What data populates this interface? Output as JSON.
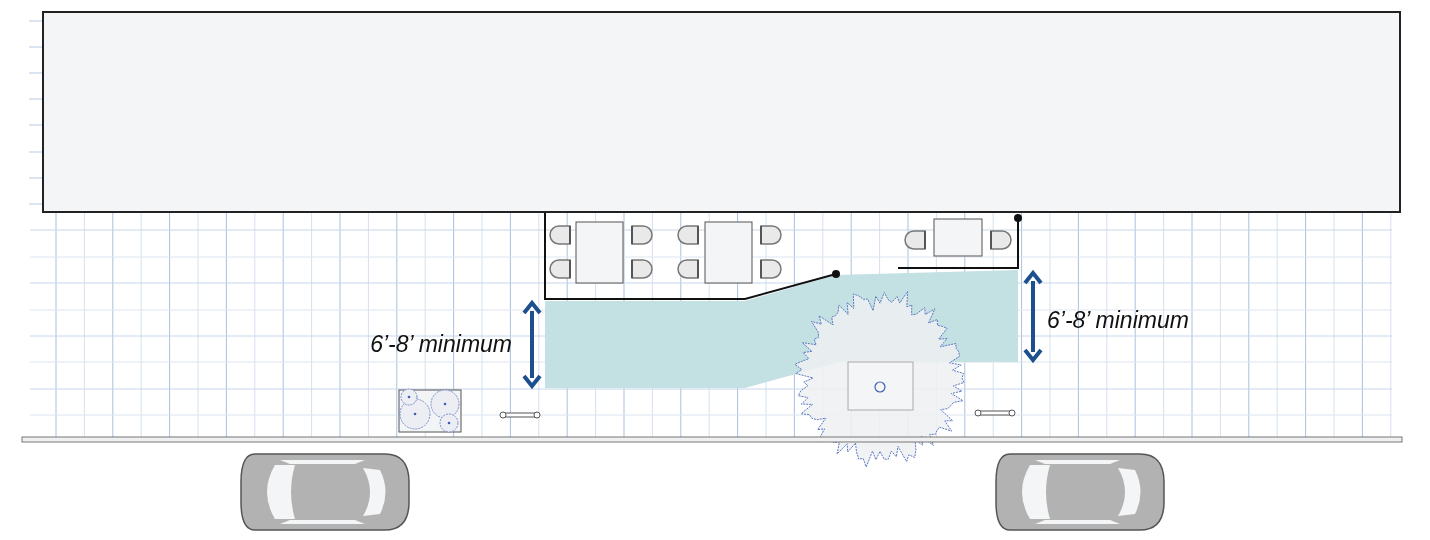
{
  "dimension_labels": [
    {
      "text": "6’-8’ minimum"
    },
    {
      "text": "6’-8’ minimum"
    }
  ]
}
